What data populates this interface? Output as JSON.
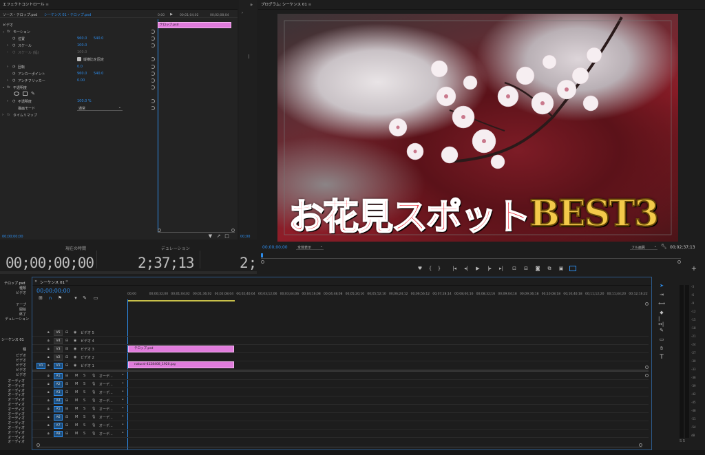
{
  "effect_controls": {
    "tab_title": "エフェクトコントロール",
    "source_label": "ソース・テロップ.psd",
    "sequence_label": "シーケンス 01・テロップ.psd",
    "section_video": "ビデオ",
    "motion": "モーション",
    "position": "位置",
    "position_x": "960.0",
    "position_y": "540.0",
    "scale": "スケール",
    "scale_value": "100.0",
    "scale_width": "スケール (幅)",
    "scale_width_value": "100.0",
    "uniform_scale": "縦横比を固定",
    "rotation": "回転",
    "rotation_value": "0.0",
    "anchor": "アンカーポイント",
    "anchor_x": "960.0",
    "anchor_y": "540.0",
    "antiflicker": "アンチフリッカー",
    "antiflicker_value": "0.00",
    "opacity": "不透明度",
    "opacity_value_label": "不透明度",
    "opacity_value": "100.0 %",
    "blend_mode": "描画モード",
    "blend_value": "通常",
    "time_remap": "タイムリマップ",
    "mini_ruler": [
      "0;00",
      "00;01;04;02",
      "00;02;08;04"
    ],
    "mini_clip": "テロップ.psd",
    "footer_time": "00;00;00;00"
  },
  "timecode_panel": {
    "current_label": "現在の時間",
    "duration_label": "デュレーション",
    "current_value": "00;00;00;00",
    "duration_value": "2;37;13",
    "extra_value": "2;"
  },
  "program": {
    "tab_title": "プログラム: シーケンス 01",
    "title_text_red": "お花見スポット",
    "title_text_gold": "BEST3",
    "timecode": "00;00;00;00",
    "fit": "全体表示",
    "resolution": "フル画質",
    "duration": "00;02;37;13"
  },
  "project": {
    "item": "テロップ.psd",
    "props": [
      "種類",
      "ビデオ"
    ],
    "props2": [
      "テープ",
      "開始",
      "終了",
      "デュレーション"
    ],
    "seq": "シーケンス 01",
    "seq_props": [
      "種",
      "ビデオ",
      "ビデオ",
      "ビデオ",
      "ビデオ",
      "ビデオ"
    ],
    "audio_props": [
      "オーディオ",
      "オーディオ",
      "オーディオ",
      "オーディオ",
      "オーディオ",
      "オーディオ",
      "オーディオ",
      "オーディオ",
      "オーディオ",
      "オーディオ",
      "オーディオ",
      "オーディオ",
      "オーディオ",
      "オーディオ"
    ]
  },
  "timeline": {
    "tab_title": "シーケンス 01",
    "timecode": "00;00;00;00",
    "ruler": [
      "00;00",
      "00;00;32;00",
      "00;01;04;02",
      "00;01;36;02",
      "00;02;08;04",
      "00;02;40;04",
      "00;03;12;06",
      "00;03;44;06",
      "00;04;16;08",
      "00;04;48;08",
      "00;05;20;10",
      "00;05;52;10",
      "00;06;24;12",
      "00;06;56;12",
      "00;07;28;14",
      "00;08;00;16",
      "00;08;32;16",
      "00;09;04;18",
      "00;09;36;18",
      "00;10;08;18",
      "00;10;40;18",
      "00;11;12;20",
      "00;11;44;20",
      "00;12;16;22"
    ],
    "video_tracks": [
      {
        "id": "V5",
        "name": "ビデオ 5"
      },
      {
        "id": "V4",
        "name": "ビデオ 4"
      },
      {
        "id": "V3",
        "name": "ビデオ 3"
      },
      {
        "id": "V2",
        "name": "ビデオ 2"
      },
      {
        "id": "V1",
        "name": "ビデオ 1",
        "src": "V1"
      }
    ],
    "audio_tracks": [
      "A1",
      "A2",
      "A3",
      "A4",
      "A5",
      "A6",
      "A7",
      "A8"
    ],
    "audio_name": "オーデ...",
    "clips": {
      "v3": "テロップ.psd",
      "v1": "natural-4128408_1920.jpg"
    }
  },
  "meter_labels": [
    "-3",
    "-6",
    "-9",
    "-12",
    "-15",
    "-18",
    "-21",
    "-24",
    "-27",
    "-30",
    "-33",
    "-36",
    "-39",
    "-42",
    "-45",
    "-48",
    "-51",
    "-54",
    "dB"
  ],
  "meter_footer": "S S",
  "colors": {
    "accent": "#2d8ceb",
    "clip": "#e07cdc",
    "panel": "#232323",
    "bg": "#1d1d1d"
  }
}
